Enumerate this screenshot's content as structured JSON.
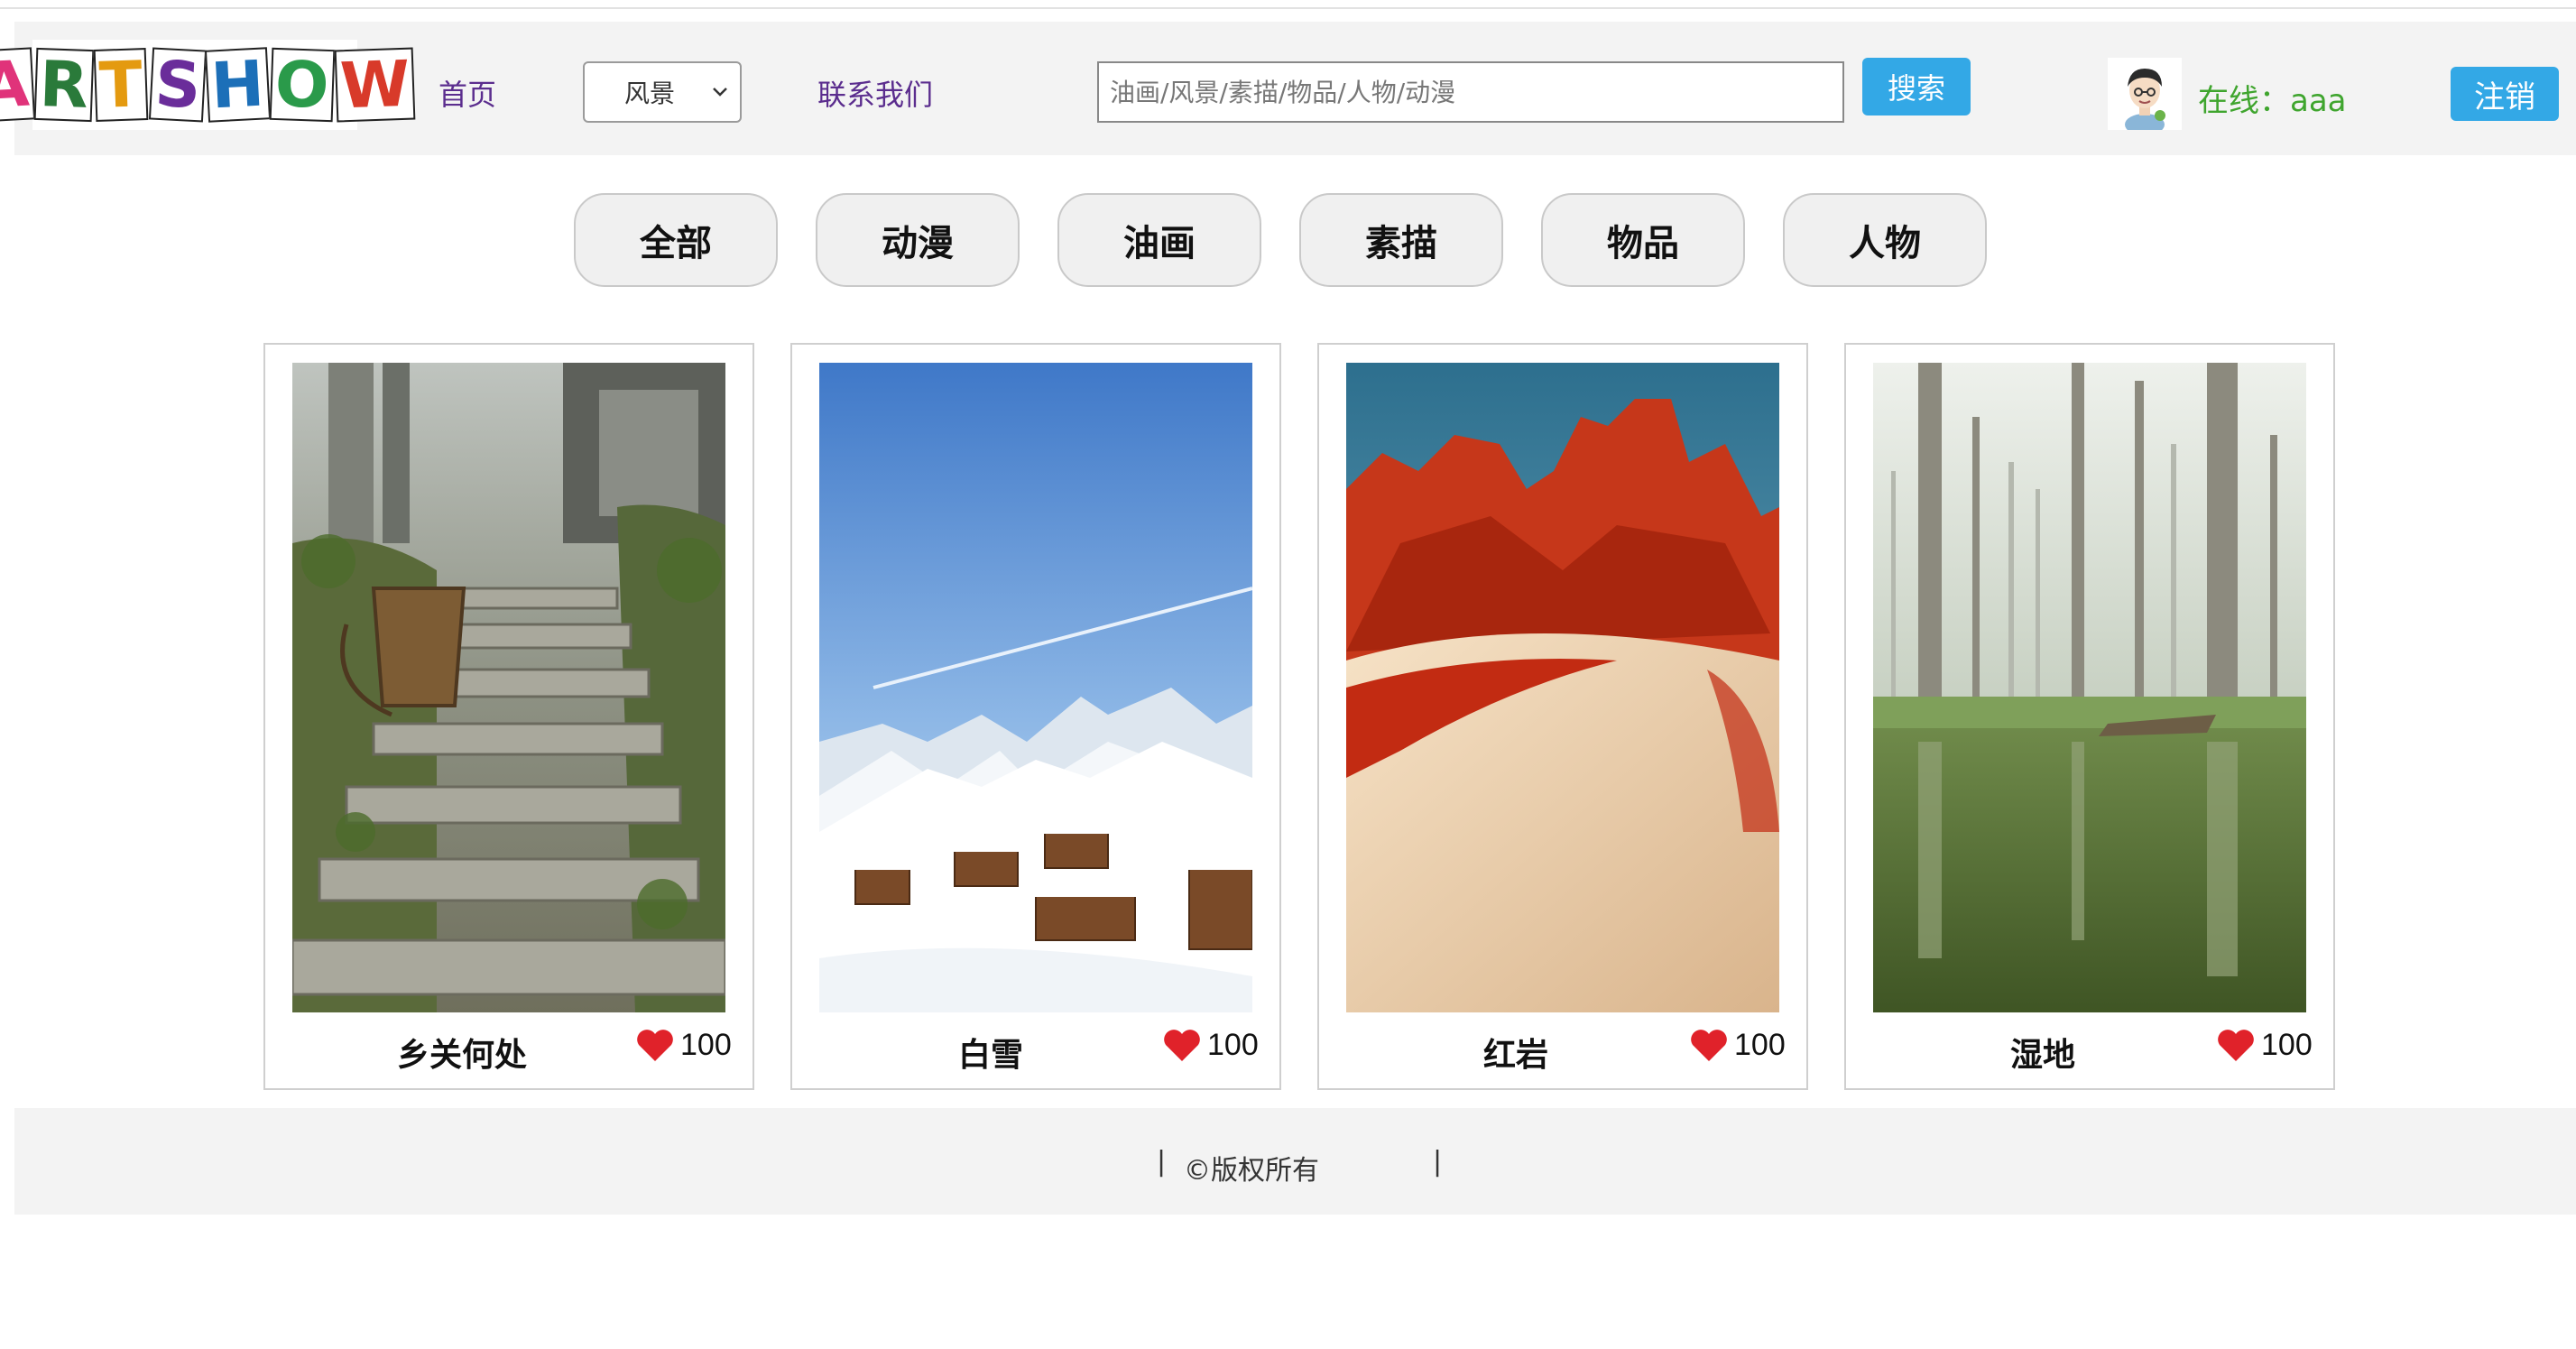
{
  "header": {
    "logo_letters": [
      "A",
      "R",
      "T",
      "S",
      "H",
      "O",
      "W"
    ],
    "nav_home": "首页",
    "category_select": {
      "value": "风景"
    },
    "nav_contact": "联系我们",
    "search": {
      "placeholder": "油画/风景/素描/物品/人物/动漫",
      "value": ""
    },
    "search_button": "搜索",
    "online_label": "在线：",
    "username": "aaa",
    "logout_button": "注销"
  },
  "categories": [
    "全部",
    "动漫",
    "油画",
    "素描",
    "物品",
    "人物"
  ],
  "cards": [
    {
      "title": "乡关何处",
      "likes": "100"
    },
    {
      "title": "白雪",
      "likes": "100"
    },
    {
      "title": "红岩",
      "likes": "100"
    },
    {
      "title": "湿地",
      "likes": "100"
    }
  ],
  "footer": {
    "pipe": "|",
    "copyright": "©版权所有"
  },
  "colors": {
    "accent_button": "#33a8e6",
    "nav_link": "#5b2d8e",
    "online_text": "#3fa52e",
    "heart": "#e0222a"
  }
}
